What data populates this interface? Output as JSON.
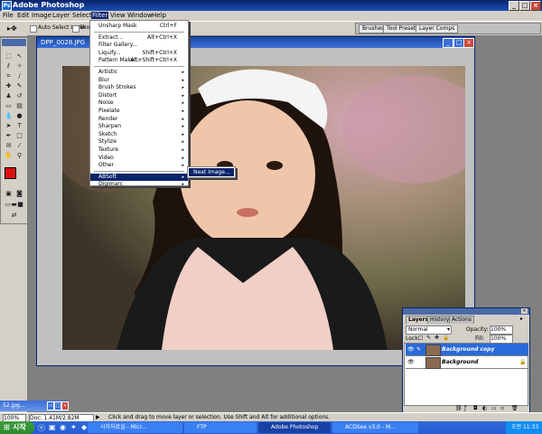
{
  "app": {
    "title": "Adobe Photoshop"
  },
  "menubar": {
    "items": [
      "File",
      "Edit",
      "Image",
      "Layer",
      "Select",
      "Filter",
      "View",
      "Window",
      "Help"
    ],
    "active": "Filter"
  },
  "options": {
    "auto_select_label": "Auto Select Layer",
    "show_label": "Show"
  },
  "palette_well": {
    "tabs": [
      "Brushes",
      "Tool Presets",
      "Layer Comps"
    ]
  },
  "document": {
    "title": "DPP_0028.JPG"
  },
  "filter_menu": {
    "items": [
      {
        "label": "Unsharp Mask",
        "shortcut": "Ctrl+F"
      },
      {
        "label": "Extract...",
        "shortcut": "Alt+Ctrl+X"
      },
      {
        "label": "Filter Gallery..."
      },
      {
        "label": "Liquify...",
        "shortcut": "Shift+Ctrl+X"
      },
      {
        "label": "Pattern Maker...",
        "shortcut": "Alt+Shift+Ctrl+X"
      },
      {
        "label": "Artistic",
        "arrow": "▸"
      },
      {
        "label": "Blur",
        "arrow": "▸"
      },
      {
        "label": "Brush Strokes",
        "arrow": "▸"
      },
      {
        "label": "Distort",
        "arrow": "▸"
      },
      {
        "label": "Noise",
        "arrow": "▸"
      },
      {
        "label": "Pixelate",
        "arrow": "▸"
      },
      {
        "label": "Render",
        "arrow": "▸"
      },
      {
        "label": "Sharpen",
        "arrow": "▸"
      },
      {
        "label": "Sketch",
        "arrow": "▸"
      },
      {
        "label": "Stylize",
        "arrow": "▸"
      },
      {
        "label": "Texture",
        "arrow": "▸"
      },
      {
        "label": "Video",
        "arrow": "▸"
      },
      {
        "label": "Other",
        "arrow": "▸"
      },
      {
        "label": "ABSoft",
        "arrow": "▸"
      },
      {
        "label": "Digimarc",
        "arrow": "▸"
      }
    ],
    "highlighted": "ABSoft",
    "submenu_item": "Neat Image..."
  },
  "layers_palette": {
    "tabs": [
      "Layers",
      "History",
      "Actions"
    ],
    "blend_mode": "Normal",
    "opacity_label": "Opacity:",
    "opacity_value": "100%",
    "lock_label": "Lock:",
    "fill_label": "Fill:",
    "fill_value": "100%",
    "layers": [
      {
        "name": "Background copy",
        "selected": true
      },
      {
        "name": "Background",
        "selected": false
      }
    ]
  },
  "minimized_doc": {
    "title": "52.jpg..."
  },
  "statusbar": {
    "zoom": "100%",
    "doc": "Doc: 1.41M/2.82M",
    "hint": "Click and drag to move layer or selection.  Use Shift and Alt for additional options."
  },
  "taskbar": {
    "start": "시작",
    "tasks": [
      "시각자료실 - Micr...",
      "FTP",
      "Adobe Photoshop",
      "ACDSee v3.0 - M..."
    ],
    "clock": "오전 11:33"
  },
  "colors": {
    "titlebar": "#0a246a",
    "selected_layer": "#2a6ad8",
    "foreground_swatch": "#e01010",
    "background_swatch": "#ffffff"
  }
}
